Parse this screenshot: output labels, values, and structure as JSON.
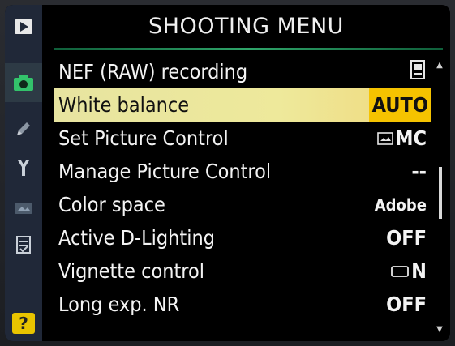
{
  "title": "SHOOTING MENU",
  "colors": {
    "selection_bar": "#eee99b",
    "selected_value_bg": "#f5c300",
    "sidebar": "#202838",
    "title_rule": "#2fa56a"
  },
  "sidebar": {
    "items": [
      {
        "icon": "playback-icon",
        "active": false
      },
      {
        "icon": "camera-icon",
        "active": true
      },
      {
        "icon": "pencil-icon",
        "active": false
      },
      {
        "icon": "wrench-icon",
        "active": false
      },
      {
        "icon": "retouch-icon",
        "active": false
      },
      {
        "icon": "my-menu-icon",
        "active": false
      },
      {
        "icon": "help-icon",
        "label": "?",
        "active": false
      }
    ]
  },
  "menu": {
    "items": [
      {
        "label": "NEF (RAW) recording",
        "value": "",
        "value_icon": "memory-card-icon"
      },
      {
        "label": "White balance",
        "value": "AUTO",
        "selected": true
      },
      {
        "label": "Set Picture Control",
        "value": "MC",
        "value_icon": "picture-control-icon"
      },
      {
        "label": "Manage Picture Control",
        "value": "--"
      },
      {
        "label": "Color space",
        "value": "Adobe"
      },
      {
        "label": "Active D-Lighting",
        "value": "OFF"
      },
      {
        "label": "Vignette control",
        "value": "N",
        "value_icon": "vignette-icon"
      },
      {
        "label": "Long exp. NR",
        "value": "OFF"
      }
    ]
  }
}
